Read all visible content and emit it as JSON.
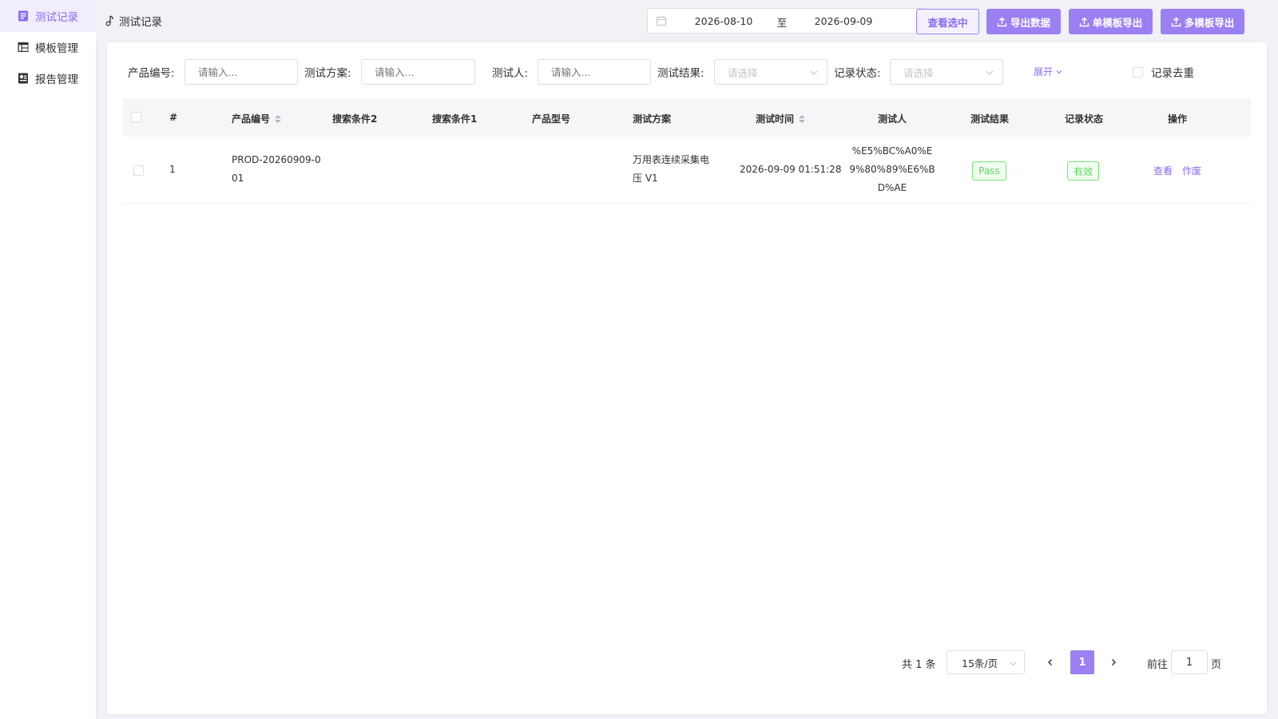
{
  "sidebar": {
    "items": [
      {
        "label": "测试记录",
        "icon": "document-list-icon"
      },
      {
        "label": "模板管理",
        "icon": "table-icon"
      },
      {
        "label": "报告管理",
        "icon": "report-icon"
      }
    ]
  },
  "header": {
    "breadcrumb": "测试记录",
    "date_start": "2026-08-10",
    "date_separator": "至",
    "date_end": "2026-09-09",
    "btn_view_selected": "查看选中",
    "btn_export_data": "导出数据",
    "btn_single_template_export": "单模板导出",
    "btn_multi_template_export": "多模板导出"
  },
  "filters": {
    "product_no_label": "产品编号:",
    "product_no_placeholder": "请输入...",
    "test_plan_label": "测试方案:",
    "test_plan_placeholder": "请输入...",
    "tester_label": "测试人:",
    "tester_placeholder": "请输入...",
    "test_result_label": "测试结果:",
    "test_result_placeholder": "请选择",
    "record_status_label": "记录状态:",
    "record_status_placeholder": "请选择",
    "expand_label": "展开",
    "dedup_label": "记录去重"
  },
  "table": {
    "columns": [
      "#",
      "产品编号",
      "搜索条件2",
      "搜索条件1",
      "产品型号",
      "测试方案",
      "测试时间",
      "测试人",
      "测试结果",
      "记录状态",
      "操作"
    ],
    "rows": [
      {
        "index": "1",
        "product_no_line1": "PROD-20260909-0",
        "product_no_line2": "01",
        "search2": "",
        "search1": "",
        "model": "",
        "plan_line1": "万用表连续采集电",
        "plan_line2": "压 V1",
        "time": "2026-09-09 01:51:28",
        "tester_line1": "%E5%BC%A0%E",
        "tester_line2": "9%80%89%E6%B",
        "tester_line3": "D%AE",
        "result": "Pass",
        "status": "有效",
        "action_view": "查看",
        "action_void": "作废"
      }
    ]
  },
  "pagination": {
    "total_text": "共 1 条",
    "page_size": "15条/页",
    "current_page": "1",
    "goto_label": "前往",
    "goto_value": "1",
    "goto_suffix": "页"
  },
  "colors": {
    "accent": "#9b80f3",
    "accent_text": "#8a6cf0",
    "success": "#5cd65c"
  }
}
